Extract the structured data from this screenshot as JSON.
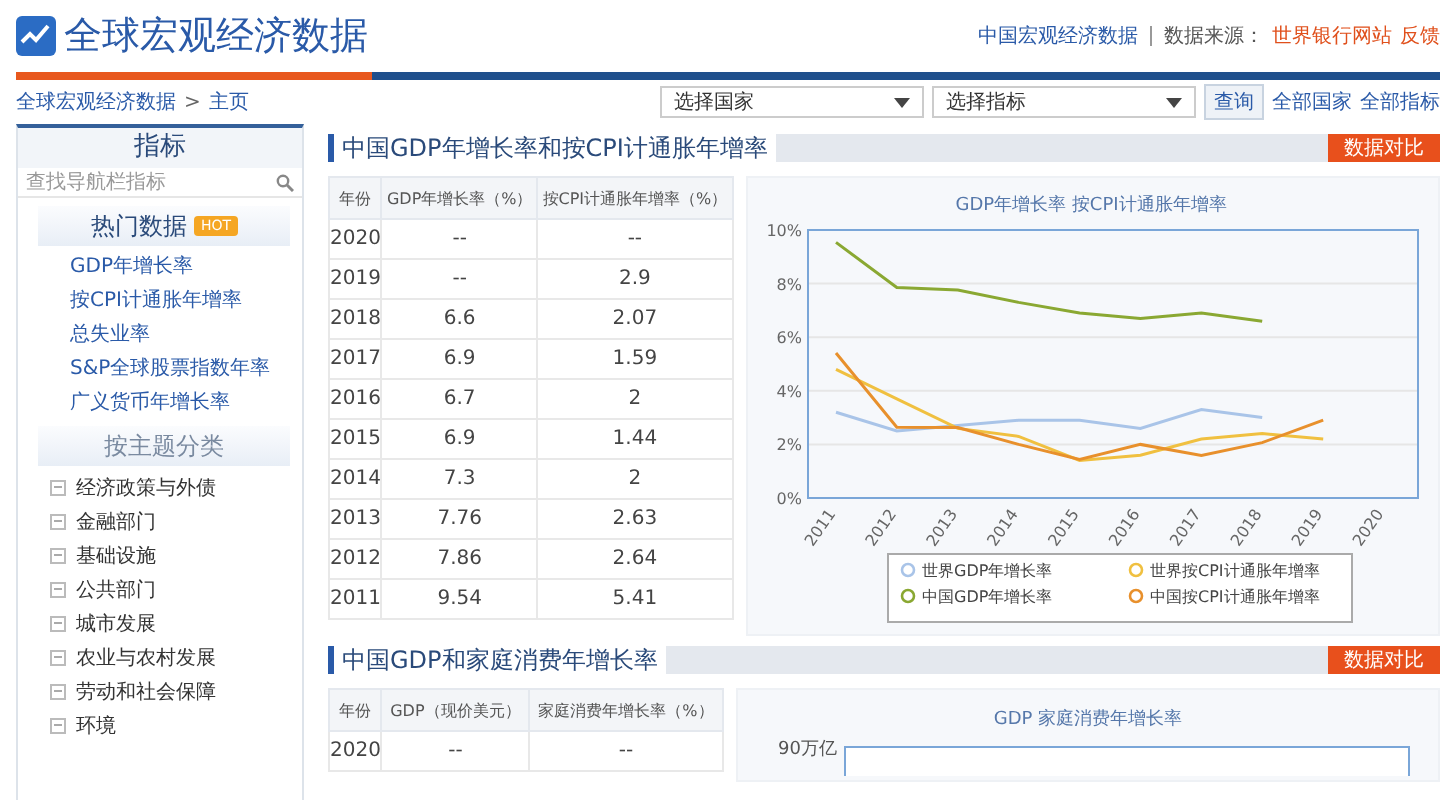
{
  "header": {
    "logo_title": "全球宏观经济数据",
    "site_link": "中国宏观经济数据",
    "source_label": "数据来源：",
    "source_link": "世界银行网站",
    "feedback_link": "反馈"
  },
  "breadcrumb": {
    "items": [
      "全球宏观经济数据",
      "主页"
    ],
    "separator": ">"
  },
  "filters": {
    "country_select": "选择国家",
    "indicator_select": "选择指标",
    "query_button": "查询",
    "links": [
      "全部国家",
      "全部指标"
    ]
  },
  "sidebar": {
    "title": "指标",
    "search": {
      "placeholder": "查找导航栏指标"
    },
    "hot": {
      "title": "热门数据",
      "badge": "HOT",
      "items": [
        "GDP年增长率",
        "按CPI计通胀年增率",
        "总失业率",
        "S&P全球股票指数年率",
        "广义货币年增长率"
      ]
    },
    "category_title": "按主题分类",
    "categories": [
      "经济政策与外债",
      "金融部门",
      "基础设施",
      "公共部门",
      "城市发展",
      "农业与农村发展",
      "劳动和社会保障",
      "环境"
    ]
  },
  "sections": [
    {
      "title": "中国GDP年增长率和按CPI计通胀年增率",
      "compare_button": "数据对比",
      "table": {
        "columns": [
          "年份",
          "GDP年增长率（%）",
          "按CPI计通胀年增率（%）"
        ],
        "rows": [
          [
            "2020",
            "--",
            "--"
          ],
          [
            "2019",
            "--",
            "2.9"
          ],
          [
            "2018",
            "6.6",
            "2.07"
          ],
          [
            "2017",
            "6.9",
            "1.59"
          ],
          [
            "2016",
            "6.7",
            "2"
          ],
          [
            "2015",
            "6.9",
            "1.44"
          ],
          [
            "2014",
            "7.3",
            "2"
          ],
          [
            "2013",
            "7.76",
            "2.63"
          ],
          [
            "2012",
            "7.86",
            "2.64"
          ],
          [
            "2011",
            "9.54",
            "5.41"
          ]
        ]
      },
      "chart": {
        "kind": "line",
        "chart_data": {
          "type": "line",
          "title": "GDP年增长率 按CPI计通胀年增率",
          "x": [
            "2011",
            "2012",
            "2013",
            "2014",
            "2015",
            "2016",
            "2017",
            "2018",
            "2019",
            "2020"
          ],
          "ylim": [
            0,
            10
          ],
          "grid": true,
          "legend": true,
          "yticks": [
            {
              "value": 0,
              "label": "0%"
            },
            {
              "value": 2,
              "label": "2%"
            },
            {
              "value": 4,
              "label": "4%"
            },
            {
              "value": 6,
              "label": "6%"
            },
            {
              "value": 8,
              "label": "8%"
            },
            {
              "value": 10,
              "label": "10%"
            }
          ],
          "series": [
            {
              "name": "世界GDP年增长率",
              "color": "#a9c4e8",
              "values": [
                3.2,
                2.5,
                2.7,
                2.9,
                2.9,
                2.6,
                3.3,
                3.0,
                null,
                null
              ]
            },
            {
              "name": "世界按CPI计通胀年增率",
              "color": "#f0c040",
              "values": [
                4.8,
                3.7,
                2.6,
                2.3,
                1.4,
                1.6,
                2.2,
                2.4,
                2.2,
                null
              ]
            },
            {
              "name": "中国GDP年增长率",
              "color": "#8aa832",
              "values": [
                9.54,
                7.86,
                7.76,
                7.3,
                6.9,
                6.7,
                6.9,
                6.6,
                null,
                null
              ]
            },
            {
              "name": "中国按CPI计通胀年增率",
              "color": "#e8902c",
              "values": [
                5.41,
                2.64,
                2.63,
                2,
                1.44,
                2,
                1.59,
                2.07,
                2.9,
                null
              ]
            }
          ]
        }
      }
    },
    {
      "title": "中国GDP和家庭消费年增长率",
      "compare_button": "数据对比",
      "table": {
        "columns": [
          "年份",
          "GDP（现价美元）",
          "家庭消费年增长率（%）"
        ],
        "rows": [
          [
            "2020",
            "--",
            "--"
          ]
        ]
      },
      "chart": {
        "kind": "frame",
        "title": "GDP 家庭消费年增长率",
        "axis_label": "90万亿"
      }
    }
  ]
}
